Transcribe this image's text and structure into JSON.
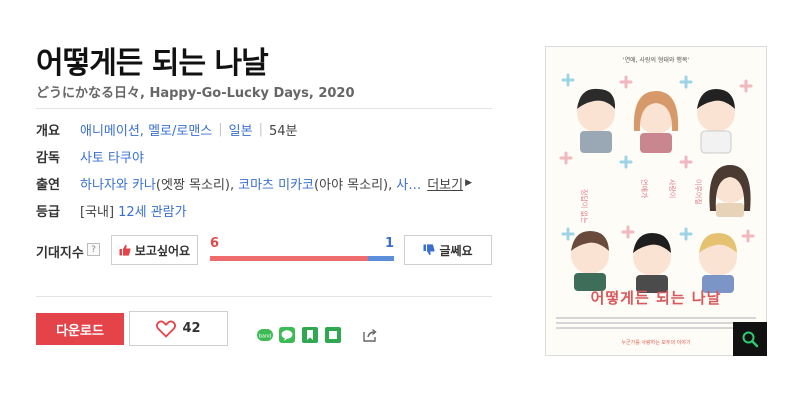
{
  "movie": {
    "title": "어떻게든 되는 나날",
    "subtitle": "どうにかなる日々, Happy-Go-Lucky Days, 2020"
  },
  "info": {
    "overview": {
      "label": "개요",
      "genre": "애니메이션, 멜로/로맨스",
      "country": "일본",
      "runtime": "54분"
    },
    "director": {
      "label": "감독",
      "name": "사토 타쿠야"
    },
    "cast": {
      "label": "출연",
      "actor1": "하나자와 카나",
      "role1": "(엣짱 목소리),",
      "actor2": "코마츠 미카코",
      "role2": "(아야 목소리),",
      "truncated": "사…",
      "more": "더보기"
    },
    "rating": {
      "label": "등급",
      "prefix": "[국내]",
      "value": "12세 관람가"
    }
  },
  "expectation": {
    "label": "기대지수",
    "help": "?",
    "want_label": "보고싶어요",
    "meh_label": "글쎄요",
    "want_count": "6",
    "meh_count": "1",
    "want_share": 0.857
  },
  "actions": {
    "download_label": "다운로드",
    "like_count": "42"
  },
  "poster": {
    "tagline": "'연애, 사랑의 형태와 행복'",
    "title": "어떻게든 되는 나날",
    "bottom": "누군가를 사랑하는 모두의 이야기"
  },
  "colors": {
    "accent_red": "#e5434a",
    "link_blue": "#3a6fd1",
    "share_green": "#3cba54"
  },
  "icons": [
    "thumbs-up-icon",
    "thumbs-down-icon",
    "heart-icon",
    "share-icon",
    "magnify-icon"
  ]
}
